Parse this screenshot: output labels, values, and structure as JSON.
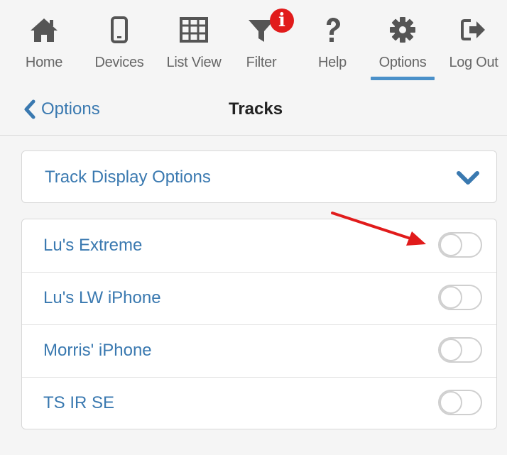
{
  "nav": {
    "items": [
      {
        "label": "Home",
        "icon": "home-icon"
      },
      {
        "label": "Devices",
        "icon": "phone-icon"
      },
      {
        "label": "List View",
        "icon": "table-icon"
      },
      {
        "label": "Filter",
        "icon": "filter-icon"
      },
      {
        "label": "Help",
        "icon": "question-icon"
      },
      {
        "label": "Options",
        "icon": "gear-icon"
      },
      {
        "label": "Log Out",
        "icon": "logout-icon"
      }
    ],
    "active": "Options",
    "filter_badge": "i"
  },
  "header": {
    "back_label": "Options",
    "title": "Tracks"
  },
  "track_display_options": {
    "label": "Track Display Options",
    "expanded": false
  },
  "devices": [
    {
      "name": "Lu's Extreme",
      "enabled": false
    },
    {
      "name": "Lu's LW iPhone",
      "enabled": false
    },
    {
      "name": "Morris' iPhone",
      "enabled": false
    },
    {
      "name": "TS IR SE",
      "enabled": false
    }
  ],
  "colors": {
    "accent": "#3a79b0",
    "icon": "#555555",
    "badge": "#e11b1b",
    "annotation_arrow": "#e11b1b"
  }
}
